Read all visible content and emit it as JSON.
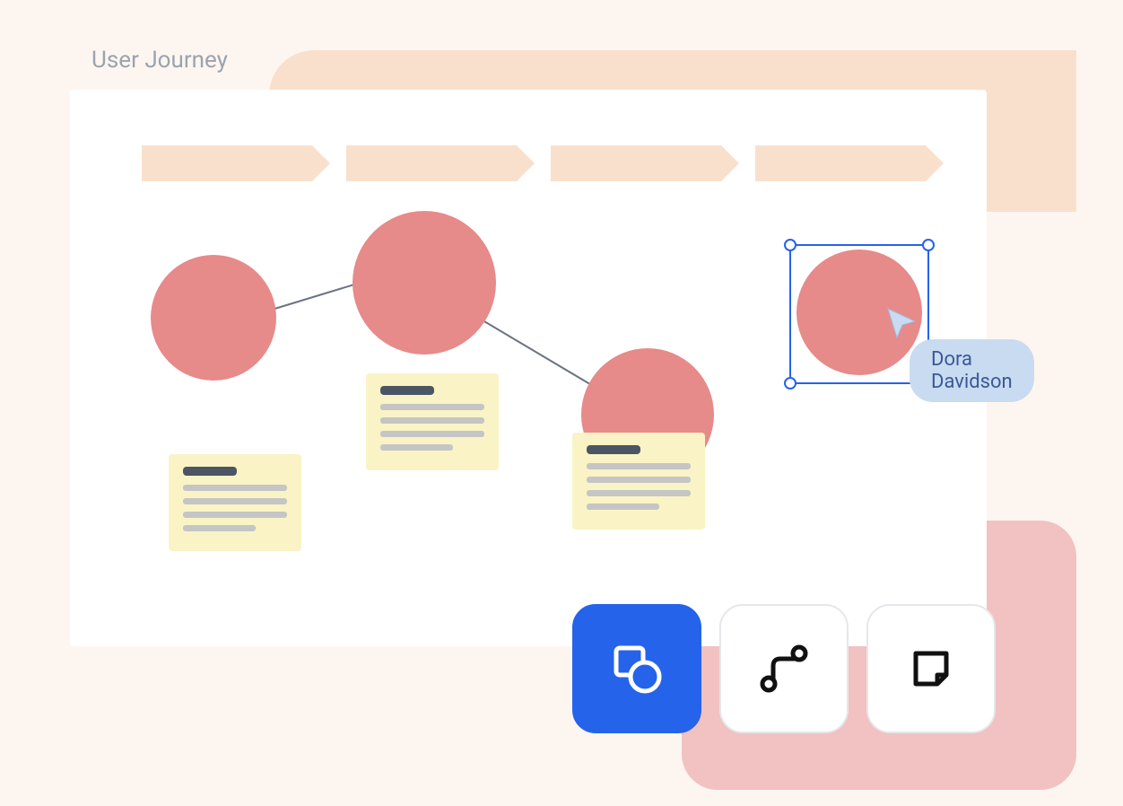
{
  "title": "User Journey",
  "collaborator": {
    "name": "Dora Davidson"
  },
  "stages": [
    {
      "id": 1
    },
    {
      "id": 2
    },
    {
      "id": 3
    },
    {
      "id": 4
    }
  ],
  "nodes": [
    {
      "id": "n1",
      "selected": false
    },
    {
      "id": "n2",
      "selected": false
    },
    {
      "id": "n3",
      "selected": false
    },
    {
      "id": "n4",
      "selected": true
    }
  ],
  "toolbar": {
    "shape_tool": {
      "active": true
    },
    "connector_tool": {
      "active": false
    },
    "sticky_tool": {
      "active": false
    }
  },
  "colors": {
    "bg": "#fdf6f0",
    "peach": "#f9e0cd",
    "pink": "#f2c1c1",
    "node": "#e78a8a",
    "sticky": "#faf3c5",
    "accent": "#2563eb",
    "badge": "#c9dbf0"
  }
}
